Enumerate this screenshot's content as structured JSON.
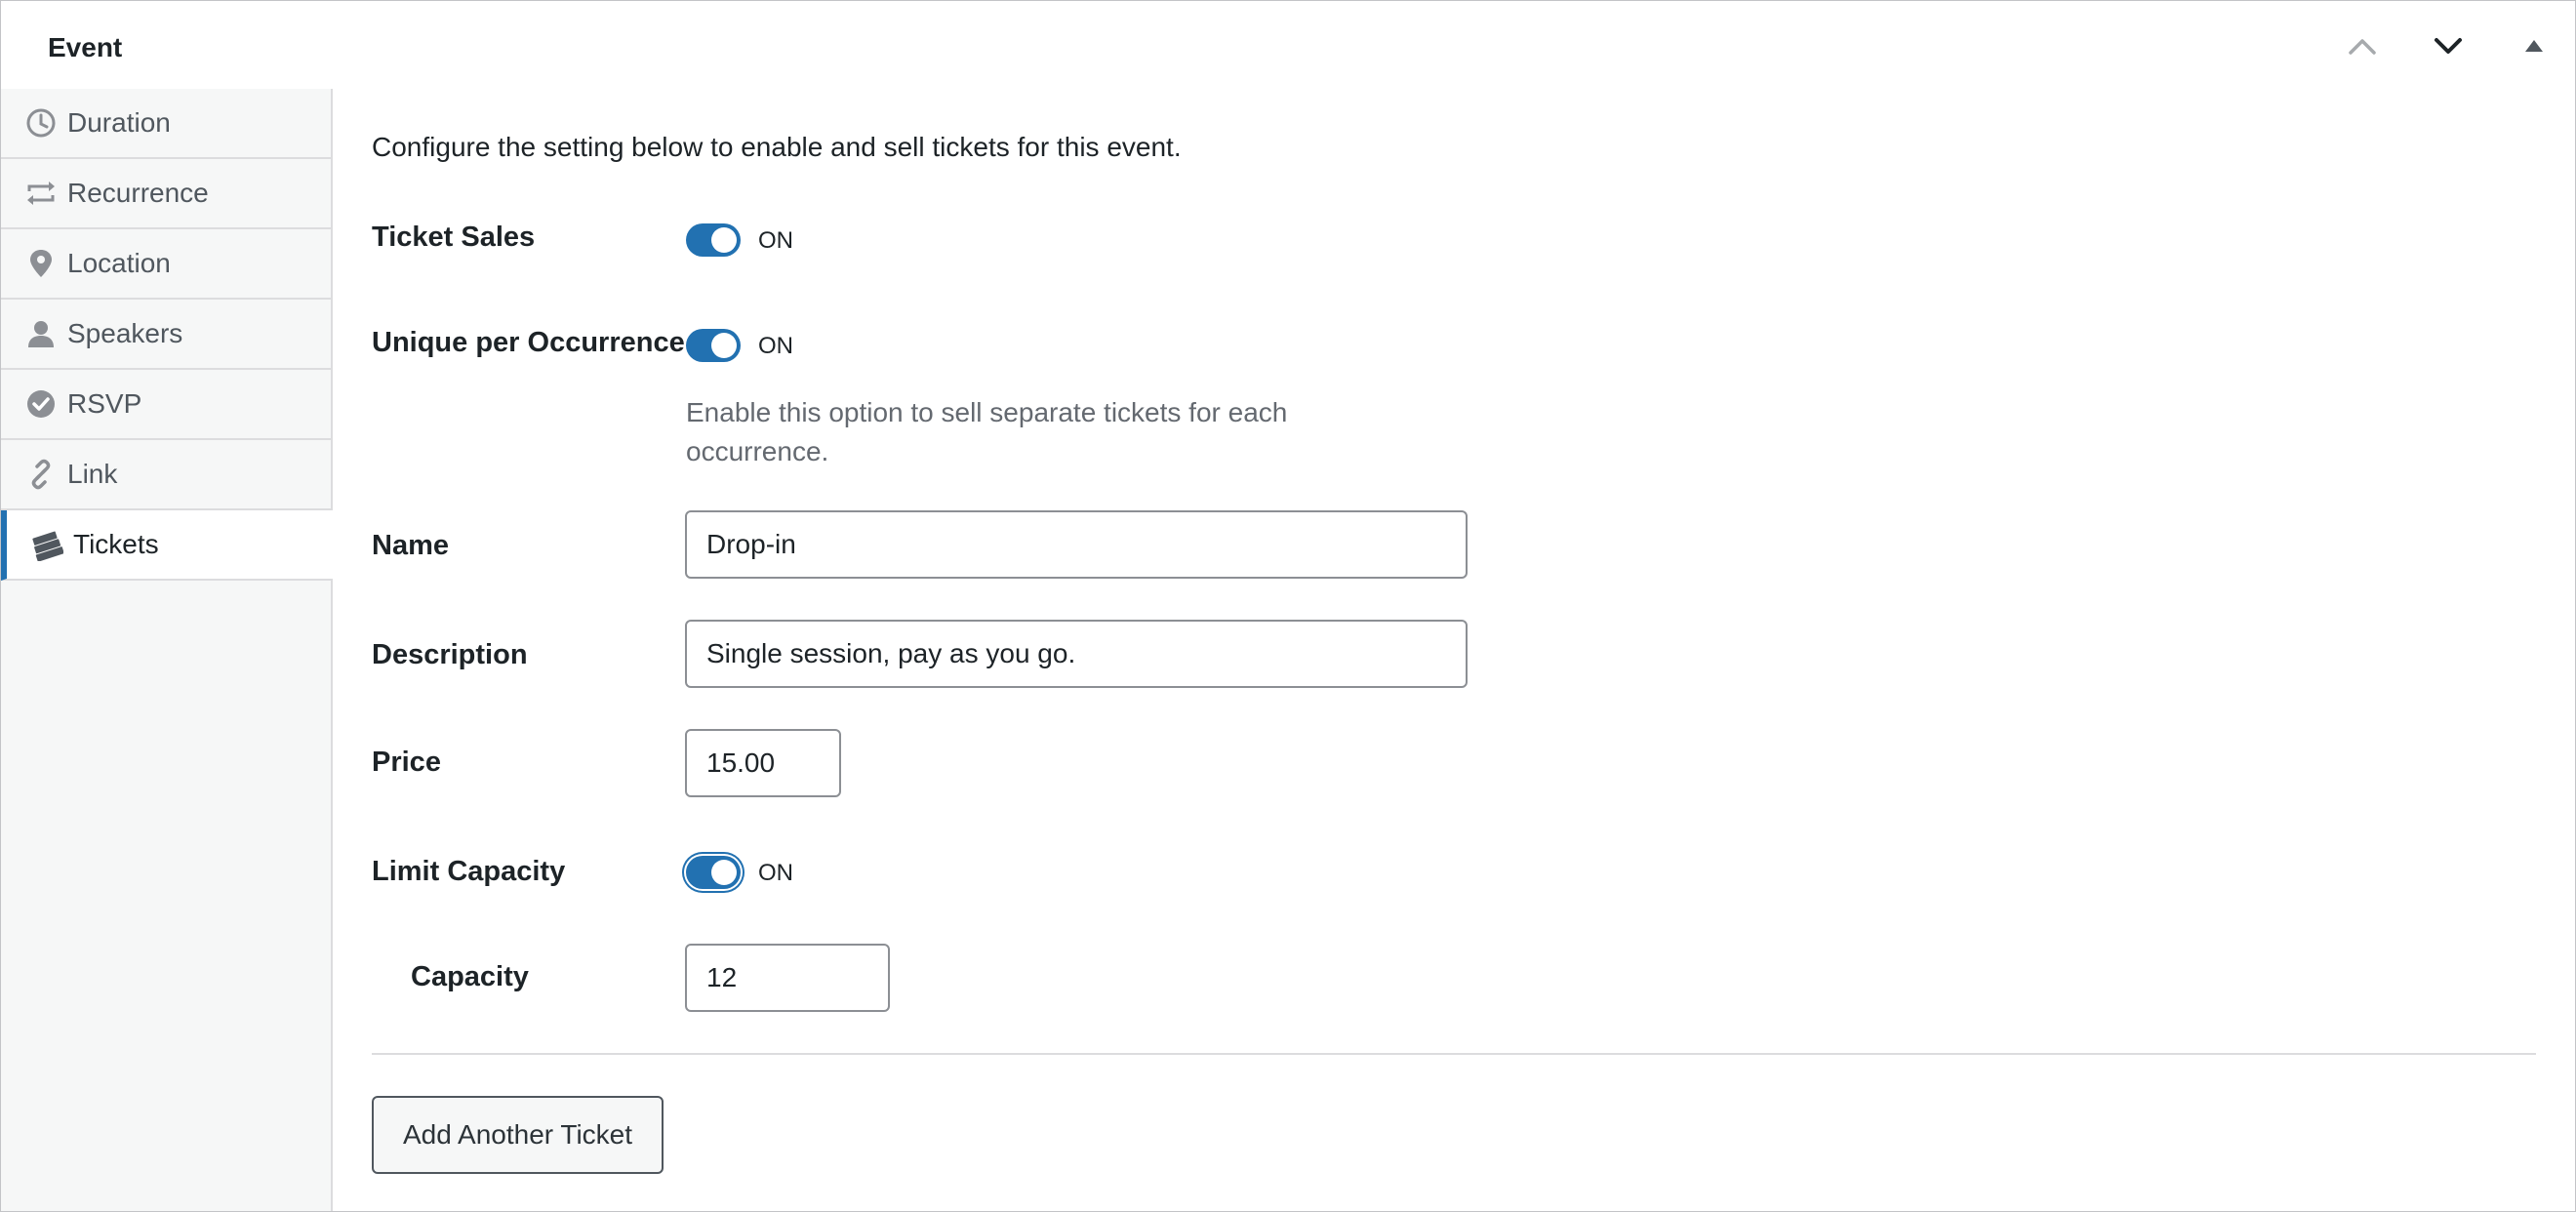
{
  "panel": {
    "title": "Event",
    "header_buttons": [
      "chevron-up-icon",
      "chevron-down-icon",
      "caret-up-icon"
    ]
  },
  "sidebar": {
    "items": [
      {
        "label": "Duration",
        "icon": "clock-icon"
      },
      {
        "label": "Recurrence",
        "icon": "repeat-icon"
      },
      {
        "label": "Location",
        "icon": "location-pin-icon"
      },
      {
        "label": "Speakers",
        "icon": "person-icon"
      },
      {
        "label": "RSVP",
        "icon": "check-circle-icon"
      },
      {
        "label": "Link",
        "icon": "link-icon"
      },
      {
        "label": "Tickets",
        "icon": "tickets-icon",
        "active": true
      }
    ]
  },
  "main": {
    "intro": "Configure the setting below to enable and sell tickets for this event.",
    "ticket_sales": {
      "label": "Ticket Sales",
      "state": "ON",
      "on": true
    },
    "unique_per_occurrence": {
      "label": "Unique per Occurrence",
      "state": "ON",
      "on": true,
      "help": "Enable this option to sell separate tickets for each occurrence."
    },
    "name": {
      "label": "Name",
      "value": "Drop-in"
    },
    "description": {
      "label": "Description",
      "value": "Single session, pay as you go."
    },
    "price": {
      "label": "Price",
      "value": "15.00"
    },
    "limit_capacity": {
      "label": "Limit Capacity",
      "state": "ON",
      "on": true
    },
    "capacity": {
      "label": "Capacity",
      "value": "12"
    },
    "add_ticket_label": "Add Another Ticket"
  },
  "colors": {
    "accent": "#2271b1",
    "sidebar_bg": "#f6f7f7",
    "border": "#dcdcde",
    "text": "#1d2327",
    "muted_text": "#646970"
  }
}
